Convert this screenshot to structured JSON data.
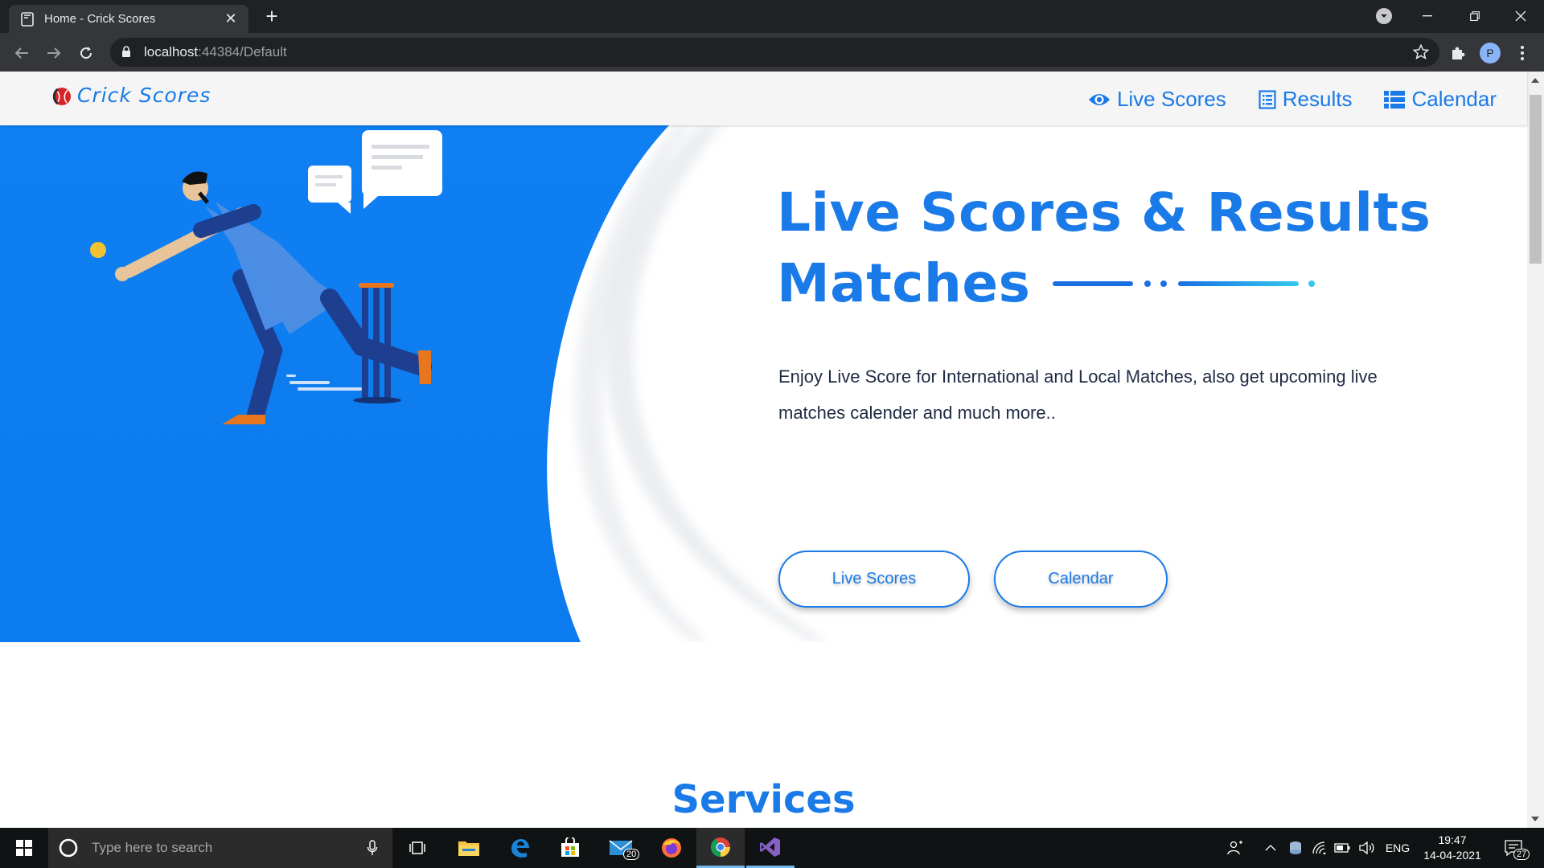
{
  "browser": {
    "tab_title": "Home - Crick Scores",
    "url_host": "localhost",
    "url_path": ":44384/Default",
    "profile_initial": "P"
  },
  "site": {
    "logo_text": "Crick Scores",
    "nav": [
      {
        "label": "Live Scores",
        "icon": "eye-icon"
      },
      {
        "label": "Results",
        "icon": "list-alt-icon"
      },
      {
        "label": "Calendar",
        "icon": "table-list-icon"
      }
    ],
    "hero": {
      "title_line1": "Live Scores & Results",
      "title_line2": "Matches",
      "description": "Enjoy Live Score for International and Local Matches, also get upcoming live matches calender and much more..",
      "buttons": [
        {
          "label": "Live Scores"
        },
        {
          "label": "Calendar"
        }
      ]
    },
    "services_title": "Services"
  },
  "taskbar": {
    "search_placeholder": "Type here to search",
    "mail_badge": "20",
    "language": "ENG",
    "time": "19:47",
    "date": "14-04-2021",
    "notifications_badge": "27"
  },
  "colors": {
    "brand_blue": "#1a7ae8",
    "hero_blue": "#0f7ff2",
    "text_dark": "#1f2a44"
  }
}
